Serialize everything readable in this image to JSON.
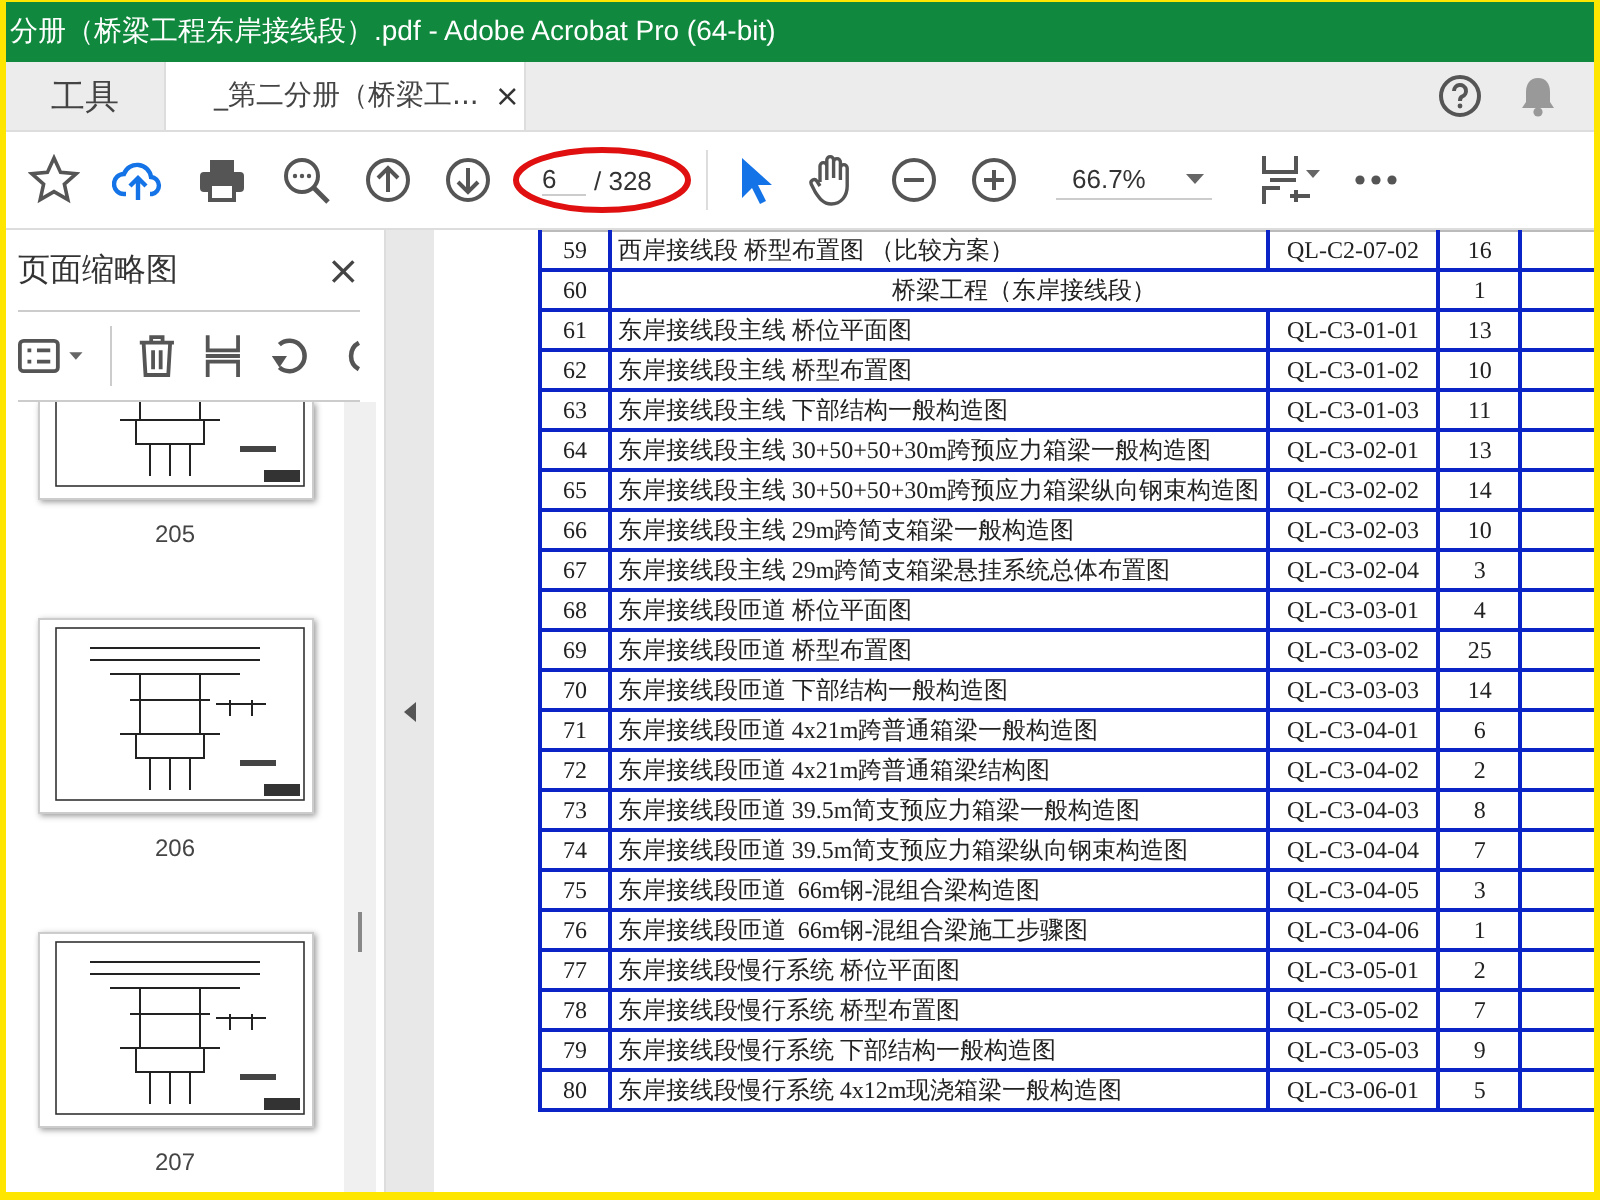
{
  "window": {
    "title": "分册（桥梁工程东岸接线段）.pdf - Adobe Acrobat Pro (64-bit)"
  },
  "tabs": [
    {
      "label": "工具",
      "selected": false
    },
    {
      "label": "_第二分册（桥梁工...",
      "selected": true,
      "close": "×"
    }
  ],
  "toolbar": {
    "page_number": "6",
    "page_count": "/ 328",
    "zoom": "66.7%"
  },
  "thumbnails_panel": {
    "title": "页面缩略图",
    "close": "×",
    "pages": [
      {
        "label": "205"
      },
      {
        "label": "206"
      },
      {
        "label": "207"
      }
    ]
  },
  "table": {
    "rows": [
      {
        "kind": "item",
        "no": "59",
        "title": "西岸接线段 桥型布置图 （比较方案）",
        "code": "QL-C2-07-02",
        "count": "16"
      },
      {
        "kind": "section",
        "no": "60",
        "title": "桥梁工程（东岸接线段）",
        "count": "1"
      },
      {
        "kind": "item",
        "no": "61",
        "title": "东岸接线段主线 桥位平面图",
        "code": "QL-C3-01-01",
        "count": "13"
      },
      {
        "kind": "item",
        "no": "62",
        "title": "东岸接线段主线 桥型布置图",
        "code": "QL-C3-01-02",
        "count": "10"
      },
      {
        "kind": "item",
        "no": "63",
        "title": "东岸接线段主线 下部结构一般构造图",
        "code": "QL-C3-01-03",
        "count": "11"
      },
      {
        "kind": "item",
        "no": "64",
        "title": "东岸接线段主线 30+50+50+30m跨预应力箱梁一般构造图",
        "code": "QL-C3-02-01",
        "count": "13"
      },
      {
        "kind": "item",
        "no": "65",
        "title": "东岸接线段主线 30+50+50+30m跨预应力箱梁纵向钢束构造图",
        "code": "QL-C3-02-02",
        "count": "14"
      },
      {
        "kind": "item",
        "no": "66",
        "title": "东岸接线段主线 29m跨简支箱梁一般构造图",
        "code": "QL-C3-02-03",
        "count": "10"
      },
      {
        "kind": "item",
        "no": "67",
        "title": "东岸接线段主线 29m跨简支箱梁悬挂系统总体布置图",
        "code": "QL-C3-02-04",
        "count": "3"
      },
      {
        "kind": "item",
        "no": "68",
        "title": "东岸接线段匝道 桥位平面图",
        "code": "QL-C3-03-01",
        "count": "4"
      },
      {
        "kind": "item",
        "no": "69",
        "title": "东岸接线段匝道 桥型布置图",
        "code": "QL-C3-03-02",
        "count": "25"
      },
      {
        "kind": "item",
        "no": "70",
        "title": "东岸接线段匝道 下部结构一般构造图",
        "code": "QL-C3-03-03",
        "count": "14"
      },
      {
        "kind": "item",
        "no": "71",
        "title": "东岸接线段匝道 4x21m跨普通箱梁一般构造图",
        "code": "QL-C3-04-01",
        "count": "6"
      },
      {
        "kind": "item",
        "no": "72",
        "title": "东岸接线段匝道 4x21m跨普通箱梁结构图",
        "code": "QL-C3-04-02",
        "count": "2"
      },
      {
        "kind": "item",
        "no": "73",
        "title": "东岸接线段匝道 39.5m简支预应力箱梁一般构造图",
        "code": "QL-C3-04-03",
        "count": "8"
      },
      {
        "kind": "item",
        "no": "74",
        "title": "东岸接线段匝道 39.5m简支预应力箱梁纵向钢束构造图",
        "code": "QL-C3-04-04",
        "count": "7"
      },
      {
        "kind": "item",
        "no": "75",
        "title": "东岸接线段匝道  66m钢-混组合梁构造图",
        "code": "QL-C3-04-05",
        "count": "3"
      },
      {
        "kind": "item",
        "no": "76",
        "title": "东岸接线段匝道  66m钢-混组合梁施工步骤图",
        "code": "QL-C3-04-06",
        "count": "1"
      },
      {
        "kind": "item",
        "no": "77",
        "title": "东岸接线段慢行系统 桥位平面图",
        "code": "QL-C3-05-01",
        "count": "2"
      },
      {
        "kind": "item",
        "no": "78",
        "title": "东岸接线段慢行系统 桥型布置图",
        "code": "QL-C3-05-02",
        "count": "7"
      },
      {
        "kind": "item",
        "no": "79",
        "title": "东岸接线段慢行系统 下部结构一般构造图",
        "code": "QL-C3-05-03",
        "count": "9"
      },
      {
        "kind": "item",
        "no": "80",
        "title": "东岸接线段慢行系统 4x12m现浇箱梁一般构造图",
        "code": "QL-C3-06-01",
        "count": "5"
      }
    ]
  }
}
